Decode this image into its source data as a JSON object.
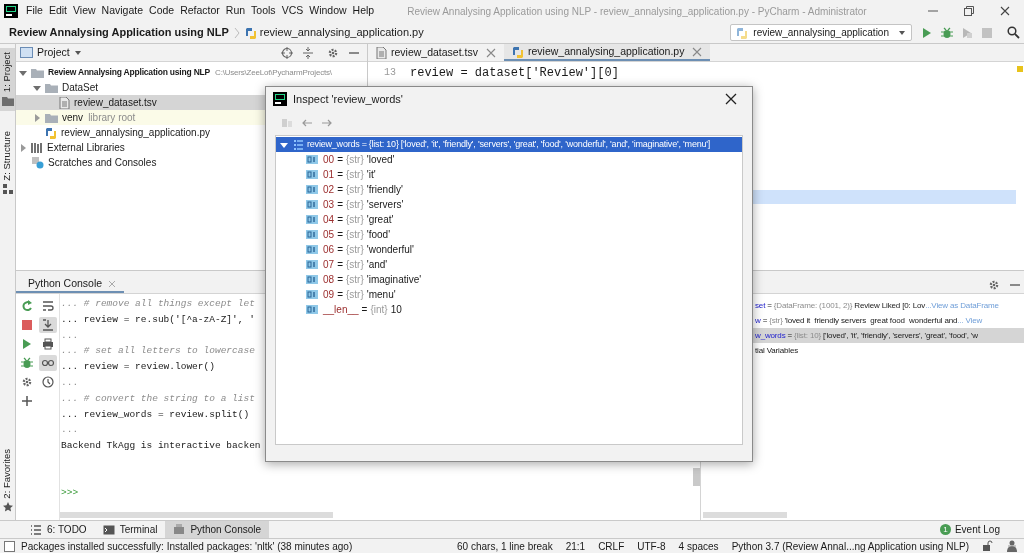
{
  "window": {
    "title": "Review Annalysing Application using NLP - review_annalysing_application.py - PyCharm - Administrator"
  },
  "menu": [
    "File",
    "Edit",
    "View",
    "Navigate",
    "Code",
    "Refactor",
    "Run",
    "Tools",
    "VCS",
    "Window",
    "Help"
  ],
  "breadcrumb": [
    "Review Annalysing Application using NLP",
    "review_annalysing_application.py"
  ],
  "run_config": {
    "label": "review_annalysing_application"
  },
  "left_strip_top": [
    {
      "label": "1: Project",
      "selected": true
    },
    {
      "label": "Z: Structure",
      "selected": false
    }
  ],
  "left_strip_bottom": [
    {
      "label": "2: Favorites",
      "selected": false
    }
  ],
  "project_panel": {
    "title": "Project",
    "tree": [
      {
        "label": "Review Annalysing Application using NLP",
        "hint": "C:\\Users\\ZeeLot\\PycharmProjects\\",
        "kind": "project",
        "expanded": true,
        "selected": false,
        "children": [
          {
            "label": "DataSet",
            "kind": "folder",
            "expanded": true,
            "selected": false,
            "children": [
              {
                "label": "review_dataset.tsv",
                "kind": "file",
                "selected": true
              }
            ]
          },
          {
            "label": "venv",
            "hint": "library root",
            "kind": "library",
            "expanded": false,
            "selected": false
          },
          {
            "label": "review_annalysing_application.py",
            "kind": "python",
            "selected": false
          }
        ]
      },
      {
        "label": "External Libraries",
        "kind": "libraries",
        "expanded": false,
        "selected": false
      },
      {
        "label": "Scratches and Consoles",
        "kind": "scratches",
        "selected": false
      }
    ]
  },
  "editor": {
    "tabs": [
      {
        "label": "review_dataset.tsv",
        "kind": "file",
        "selected": false
      },
      {
        "label": "review_annalysing_application.py",
        "kind": "python",
        "selected": true
      }
    ],
    "lines": [
      {
        "number": "13",
        "code": "review = dataset['Review'][0]"
      }
    ]
  },
  "inspect_dialog": {
    "title": "Inspect 'review_words'",
    "root": {
      "name": "review_words",
      "sign": "=",
      "type": "{list: 10}",
      "value": "['loved', 'it', 'friendly', 'servers', 'great', 'food', 'wonderful', 'and', 'imaginative', 'menu']",
      "expanded": true,
      "selected": true,
      "children": [
        {
          "name": "00",
          "sign": "=",
          "type": "{str}",
          "value": "'loved'",
          "selected": false
        },
        {
          "name": "01",
          "sign": "=",
          "type": "{str}",
          "value": "'it'",
          "selected": false
        },
        {
          "name": "02",
          "sign": "=",
          "type": "{str}",
          "value": "'friendly'",
          "selected": false
        },
        {
          "name": "03",
          "sign": "=",
          "type": "{str}",
          "value": "'servers'",
          "selected": false
        },
        {
          "name": "04",
          "sign": "=",
          "type": "{str}",
          "value": "'great'",
          "selected": false
        },
        {
          "name": "05",
          "sign": "=",
          "type": "{str}",
          "value": "'food'",
          "selected": false
        },
        {
          "name": "06",
          "sign": "=",
          "type": "{str}",
          "value": "'wonderful'",
          "selected": false
        },
        {
          "name": "07",
          "sign": "=",
          "type": "{str}",
          "value": "'and'",
          "selected": false
        },
        {
          "name": "08",
          "sign": "=",
          "type": "{str}",
          "value": "'imaginative'",
          "selected": false
        },
        {
          "name": "09",
          "sign": "=",
          "type": "{str}",
          "value": "'menu'",
          "selected": false
        },
        {
          "name": "__len__",
          "sign": "=",
          "type": "{int}",
          "value": "10",
          "selected": false
        }
      ]
    }
  },
  "console": {
    "tab": {
      "label": "Python Console",
      "selected": true
    },
    "lines": [
      {
        "kind": "comment",
        "text": "... # remove all things except let"
      },
      {
        "kind": "code",
        "text": "... review = re.sub('[^a-zA-Z]', '"
      },
      {
        "kind": "continuation",
        "text": "..."
      },
      {
        "kind": "comment",
        "text": "... # set all letters to lowercase"
      },
      {
        "kind": "code",
        "text": "... review = review.lower()"
      },
      {
        "kind": "continuation",
        "text": "..."
      },
      {
        "kind": "comment",
        "text": "... # convert the string to a list"
      },
      {
        "kind": "code",
        "text": "... review_words = review.split()"
      },
      {
        "kind": "continuation",
        "text": "..."
      },
      {
        "kind": "output",
        "text": "Backend TkAgg is interactive backen"
      },
      {
        "kind": "prompt",
        "text": ">>>"
      }
    ]
  },
  "variables": [
    {
      "kind": "variable",
      "name": "set",
      "sign": "=",
      "type": "{DataFrame: (1001, 2)}",
      "value": "Review Liked [0: Lov",
      "link": "...View as DataFrame",
      "selected": false
    },
    {
      "kind": "variable",
      "name": "w",
      "sign": "=",
      "type": "{str}",
      "value": "'loved it  friendly servers  great food  wonderful and",
      "link": "... View",
      "selected": false
    },
    {
      "kind": "variable",
      "name": "w_words",
      "sign": "=",
      "type": "{list: 10}",
      "value": "['loved', 'it', 'friendly', 'servers', 'great', 'food', 'w",
      "selected": true
    },
    {
      "kind": "group",
      "name": "tial Variables",
      "selected": false
    }
  ],
  "tool_tabs": [
    {
      "label": "6: TODO",
      "kind": "todo",
      "selected": false
    },
    {
      "label": "Terminal",
      "kind": "terminal",
      "selected": false
    },
    {
      "label": "Python Console",
      "kind": "console",
      "selected": true
    }
  ],
  "event_log": {
    "label": "Event Log",
    "count": "1"
  },
  "status_bar": {
    "message": "Packages installed successfully: Installed packages: 'nltk' (38 minutes ago)",
    "items": [
      "60 chars, 1 line break",
      "21:1",
      "CRLF",
      "UTF-8",
      "4 spaces",
      "Python 3.7 (Review Annal...ng Application using NLP)"
    ]
  }
}
